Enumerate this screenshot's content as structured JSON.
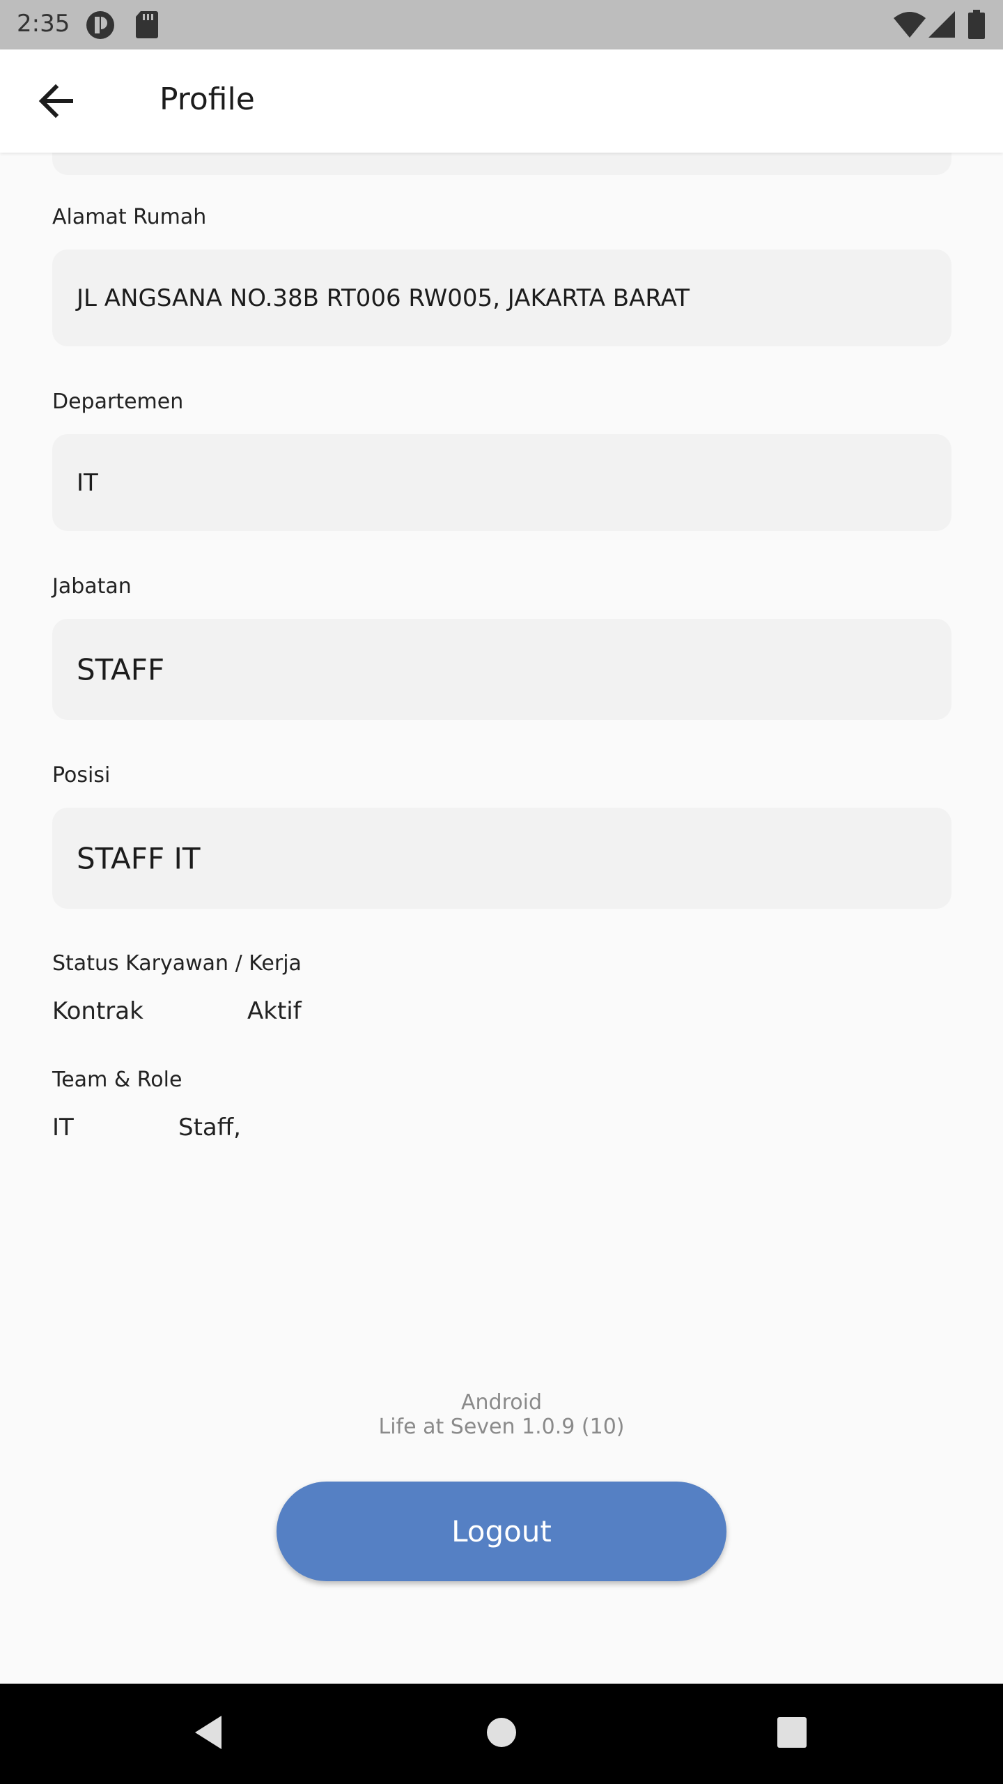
{
  "status_bar": {
    "time": "2:35",
    "icons": [
      "notification-app-icon",
      "sd-card-icon",
      "wifi-icon",
      "signal-icon",
      "battery-icon"
    ]
  },
  "app_bar": {
    "title": "Profile",
    "back_icon": "arrow-back-icon"
  },
  "form": {
    "address": {
      "label": "Alamat Rumah",
      "value": "JL ANGSANA NO.38B RT006 RW005, JAKARTA BARAT"
    },
    "department": {
      "label": "Departemen",
      "value": "IT"
    },
    "title": {
      "label": "Jabatan",
      "value": "STAFF"
    },
    "position": {
      "label": "Posisi",
      "value": "STAFF IT"
    }
  },
  "employment_status": {
    "label": "Status Karyawan / Kerja",
    "type": "Kontrak",
    "state": "Aktif"
  },
  "team_role": {
    "label": "Team & Role",
    "team": "IT",
    "role": "Staff,"
  },
  "app_info": {
    "platform": "Android",
    "version": "Life at Seven 1.0.9 (10)"
  },
  "logout_label": "Logout",
  "colors": {
    "accent": "#5580c4",
    "field_background": "#f2f2f2",
    "page_background": "#fafafa",
    "status_bar": "#bdbdbd"
  },
  "nav_bar": {
    "buttons": [
      "back-triangle-icon",
      "home-circle-icon",
      "recents-square-icon"
    ]
  }
}
